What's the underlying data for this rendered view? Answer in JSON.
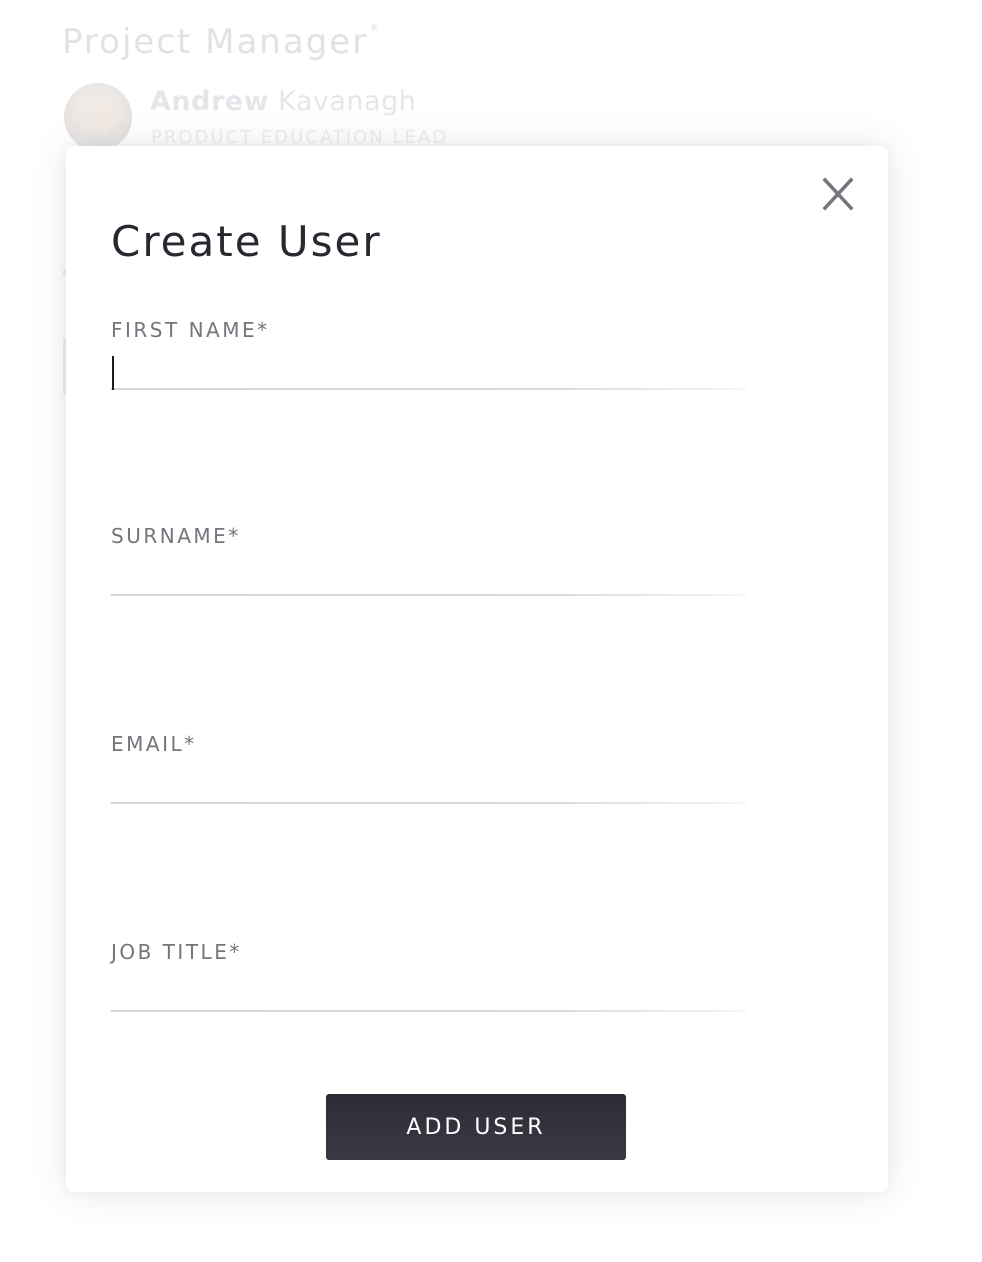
{
  "background": {
    "section_title": "Project Manager",
    "required_mark": "*",
    "user": {
      "first_name": "Andrew",
      "last_name": "Kavanagh",
      "role": "PRODUCT EDUCATION LEAD"
    }
  },
  "modal": {
    "title": "Create User",
    "close_icon": "close-icon",
    "fields": [
      {
        "label": "FIRST NAME*",
        "value": "",
        "focused": true
      },
      {
        "label": "SURNAME*",
        "value": ""
      },
      {
        "label": "EMAIL*",
        "value": ""
      },
      {
        "label": "JOB TITLE*",
        "value": ""
      }
    ],
    "submit_label": "ADD USER"
  },
  "colors": {
    "button_bg": "#34303c",
    "title_text": "#2a2730",
    "label_text": "#76747c",
    "close_icon": "#76747c"
  }
}
